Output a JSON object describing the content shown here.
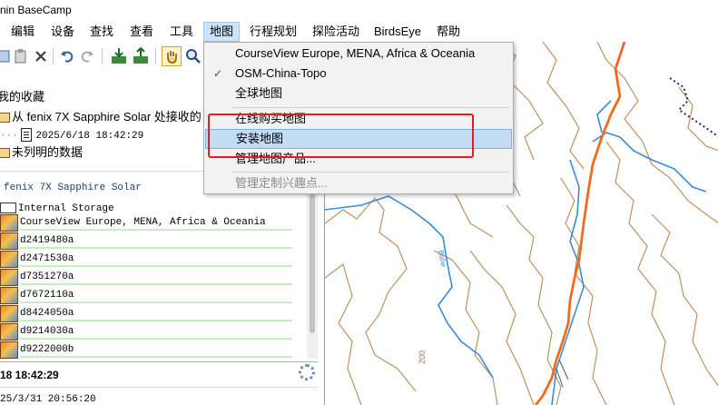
{
  "app": {
    "title": "nin BaseCamp"
  },
  "menubar": {
    "items": [
      "编辑",
      "设备",
      "查找",
      "查看",
      "工具",
      "地图",
      "行程规划",
      "探险活动",
      "BirdsEye",
      "帮助"
    ]
  },
  "dropdown": {
    "items": [
      {
        "label": "CourseView Europe, MENA, Africa & Oceania",
        "checked": false,
        "highlighted": false,
        "disabled": false
      },
      {
        "label": "OSM-China-Topo",
        "checked": true,
        "highlighted": false,
        "disabled": false
      },
      {
        "label": "全球地图",
        "checked": false,
        "highlighted": false,
        "disabled": false
      },
      {
        "label": "在线购买地图",
        "checked": false,
        "highlighted": false,
        "disabled": false
      },
      {
        "label": "安装地图",
        "checked": false,
        "highlighted": true,
        "disabled": false
      },
      {
        "label": "管理地图产品...",
        "checked": false,
        "highlighted": false,
        "disabled": false
      },
      {
        "label": "管理定制兴趣点...",
        "checked": false,
        "highlighted": false,
        "disabled": true
      }
    ],
    "check_glyph": "✓"
  },
  "left_panel": {
    "my_collection": "我的收藏",
    "received_from": "从 fenix 7X Sapphire Solar 处接收的",
    "received_date": "2025/6/18 18:42:29",
    "unlisted": "未列明的数据",
    "device_name": "fenix 7X Sapphire Solar",
    "storage": "Internal Storage",
    "maps": [
      "CourseView Europe, MENA, Africa & Oceania",
      "d2419480a",
      "d2471530a",
      "d7351270a",
      "d7672110a",
      "d8424050a",
      "d9214030a",
      "d9222000b"
    ],
    "footer_time": "18 18:42:29",
    "footer_time2": "25/3/31 20:56:20"
  },
  "map": {
    "contour_label": "200",
    "river_label": "Bahe",
    "colors": {
      "contour": "#c09060",
      "river": "#3a8ad8",
      "route": "#f06b1e",
      "boundary": "#1a2a80"
    }
  },
  "colors": {
    "highlight": "#c4dcf3",
    "annotation_box": "#e41c22",
    "active_menu": "#cce4f7"
  }
}
